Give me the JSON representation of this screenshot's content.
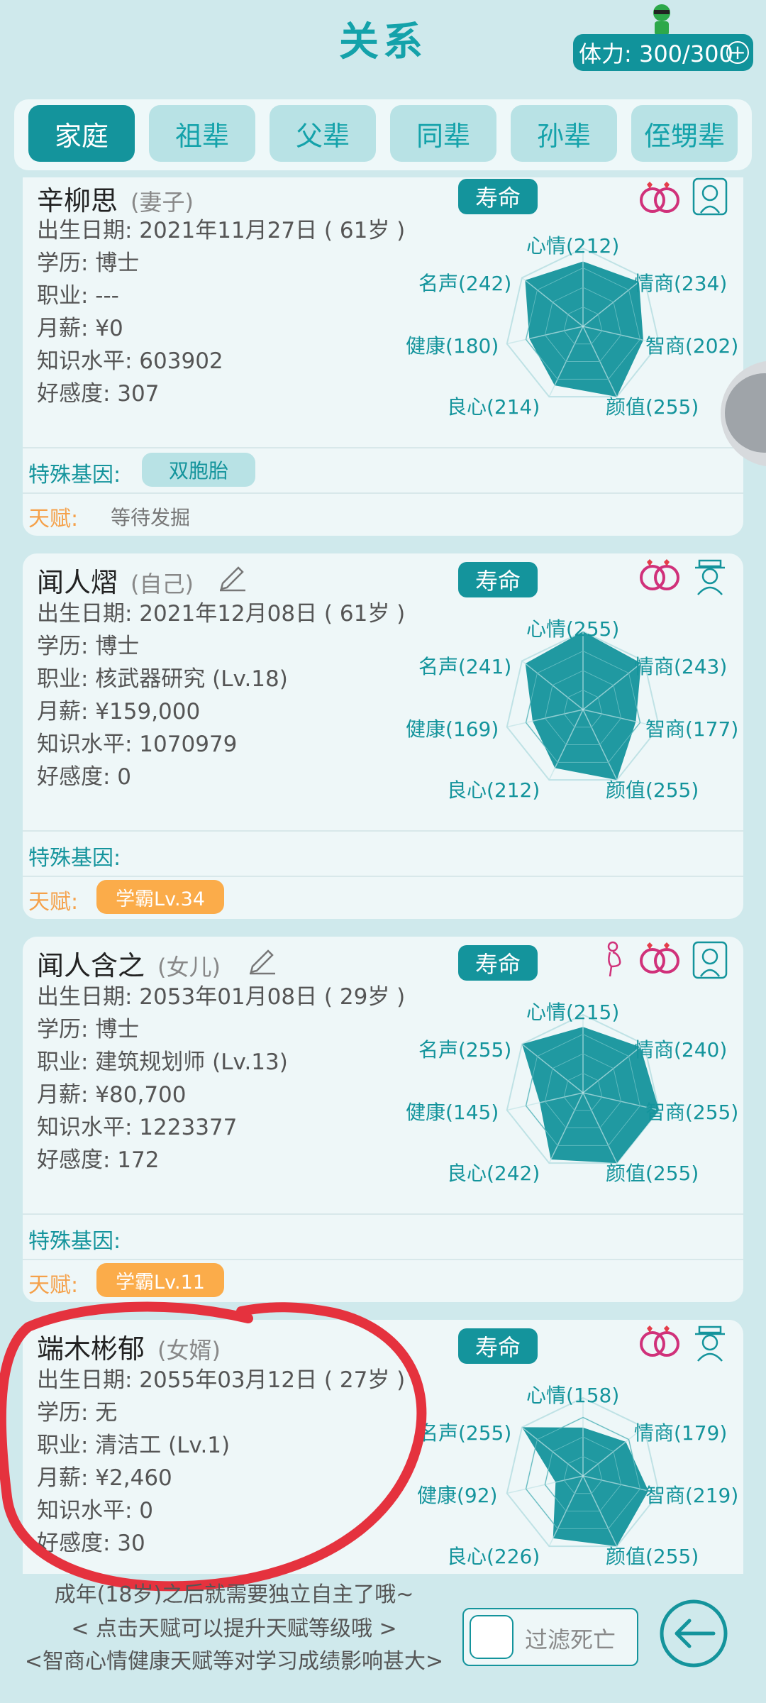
{
  "header": {
    "title": "关系",
    "stamina": "体力: 300/300",
    "stamina_plus": "+"
  },
  "tabs": [
    {
      "label": "家庭",
      "active": true
    },
    {
      "label": "祖辈",
      "active": false
    },
    {
      "label": "父辈",
      "active": false
    },
    {
      "label": "同辈",
      "active": false
    },
    {
      "label": "孙辈",
      "active": false
    },
    {
      "label": "侄甥辈",
      "active": false
    }
  ],
  "labels": {
    "lifespan": "寿命",
    "gene": "特殊基因:",
    "talent": "天赋:"
  },
  "cards": [
    {
      "name": "辛柳思",
      "relation": "(妻子)",
      "birth": "出生日期: 2021年11月27日 ( 61岁 )",
      "education": "学历: 博士",
      "job": "职业: ---",
      "salary": "月薪: ¥0",
      "knowledge": "知识水平: 603902",
      "favor": "好感度: 307",
      "gene": "双胞胎",
      "talent_text": "等待发掘",
      "radar": {
        "mood": 212,
        "eq": 234,
        "iq": 202,
        "looks": 255,
        "conscience": 214,
        "health": 180,
        "fame": 242
      },
      "radar_labels": {
        "mood": "心情(212)",
        "eq": "情商(234)",
        "iq": "智商(202)",
        "looks": "颜值(255)",
        "conscience": "良心(214)",
        "health": "健康(180)",
        "fame": "名声(242)"
      }
    },
    {
      "name": "闻人熠",
      "relation": "(自己)",
      "birth": "出生日期: 2021年12月08日 ( 61岁 )",
      "education": "学历: 博士",
      "job": "职业: 核武器研究 (Lv.18)",
      "salary": "月薪: ¥159,000",
      "knowledge": "知识水平: 1070979",
      "favor": "好感度: 0",
      "talent_chip": "学霸Lv.34",
      "radar": {
        "mood": 255,
        "eq": 243,
        "iq": 177,
        "looks": 255,
        "conscience": 212,
        "health": 169,
        "fame": 241
      },
      "radar_labels": {
        "mood": "心情(255)",
        "eq": "情商(243)",
        "iq": "智商(177)",
        "looks": "颜值(255)",
        "conscience": "良心(212)",
        "health": "健康(169)",
        "fame": "名声(241)"
      }
    },
    {
      "name": "闻人含之",
      "relation": "(女儿)",
      "birth": "出生日期: 2053年01月08日 ( 29岁 )",
      "education": "学历: 博士",
      "job": "职业: 建筑规划师 (Lv.13)",
      "salary": "月薪: ¥80,700",
      "knowledge": "知识水平: 1223377",
      "favor": "好感度: 172",
      "talent_chip": "学霸Lv.11",
      "radar": {
        "mood": 215,
        "eq": 240,
        "iq": 255,
        "looks": 255,
        "conscience": 242,
        "health": 145,
        "fame": 255
      },
      "radar_labels": {
        "mood": "心情(215)",
        "eq": "情商(240)",
        "iq": "智商(255)",
        "looks": "颜值(255)",
        "conscience": "良心(242)",
        "health": "健康(145)",
        "fame": "名声(255)"
      }
    },
    {
      "name": "端木彬郁",
      "relation": "(女婿)",
      "birth": "出生日期: 2055年03月12日 ( 27岁 )",
      "education": "学历: 无",
      "job": "职业: 清洁工 (Lv.1)",
      "salary": "月薪: ¥2,460",
      "knowledge": "知识水平: 0",
      "favor": "好感度: 30",
      "radar": {
        "mood": 158,
        "eq": 179,
        "iq": 219,
        "looks": 255,
        "conscience": 226,
        "health": 92,
        "fame": 255
      },
      "radar_labels": {
        "mood": "心情(158)",
        "eq": "情商(179)",
        "iq": "智商(219)",
        "looks": "颜值(255)",
        "conscience": "良心(226)",
        "health": "健康(92)",
        "fame": "名声(255)"
      }
    }
  ],
  "footer": {
    "tip1": "成年(18岁)之后就需要独立自主了哦~",
    "tip2": "< 点击天赋可以提升天赋等级哦 >",
    "tip3": "<智商心情健康天赋等对学习成绩影响甚大>",
    "filter_label": "过滤死亡"
  },
  "colors": {
    "accent": "#14949c",
    "background": "#cfe9ec",
    "talent": "#fbac4a",
    "marker": "#e5323e",
    "heart": "#d0317a"
  }
}
